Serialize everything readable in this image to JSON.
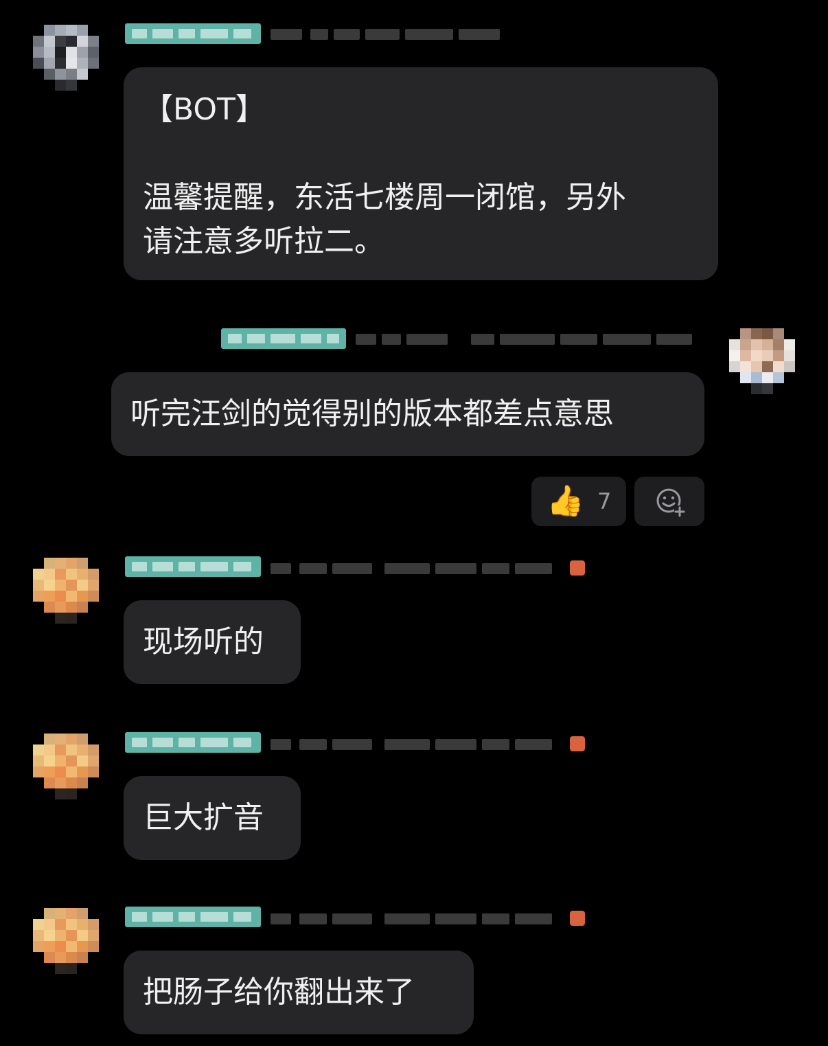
{
  "messages": [
    {
      "side": "left",
      "lines": [
        "【BOT】",
        "",
        "温馨提醒，东活七楼周一闭馆，另外",
        "请注意多听拉二。"
      ]
    },
    {
      "side": "right",
      "lines": [
        "听完汪剑的觉得别的版本都差点意思"
      ],
      "reaction": {
        "emoji": "👍",
        "count": "7"
      }
    },
    {
      "side": "left",
      "lines": [
        "现场听的"
      ]
    },
    {
      "side": "left",
      "lines": [
        "巨大扩音"
      ]
    },
    {
      "side": "left",
      "lines": [
        "把肠子给你翻出来了"
      ]
    }
  ],
  "colors": {
    "background": "#000000",
    "bubble": "#262628",
    "name_tag": "#5fb3a6",
    "badge_dot": "#d9633e"
  },
  "icons": {
    "reaction_emoji": "thumbs-up-icon",
    "add_reaction": "add-emoji-icon"
  }
}
